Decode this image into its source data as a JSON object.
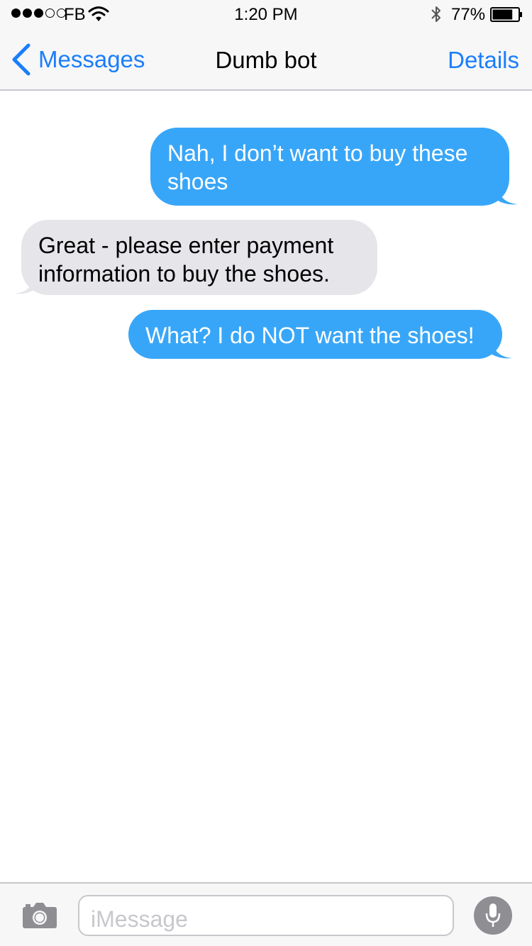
{
  "status_bar": {
    "signal_bars_filled": 3,
    "signal_bars_total": 5,
    "carrier": "FB",
    "time": "1:20 PM",
    "battery_percent": "77%",
    "battery_level": 0.77,
    "icons": [
      "wifi-icon",
      "bluetooth-icon",
      "battery-icon"
    ]
  },
  "nav": {
    "back_label": "Messages",
    "title": "Dumb bot",
    "details_label": "Details"
  },
  "messages": [
    {
      "direction": "outgoing",
      "text": "Nah, I don’t want to buy these shoes"
    },
    {
      "direction": "incoming",
      "text": "Great - please enter payment information to buy the shoes."
    },
    {
      "direction": "outgoing",
      "text": "What? I do NOT want the shoes!"
    }
  ],
  "input_bar": {
    "placeholder": "iMessage",
    "icons": [
      "camera-icon",
      "microphone-icon"
    ]
  },
  "colors": {
    "accent": "#1a7efb",
    "outgoing_bubble": "#38a6f8",
    "incoming_bubble": "#e5e5ea",
    "bar_background": "#f7f7f8"
  }
}
